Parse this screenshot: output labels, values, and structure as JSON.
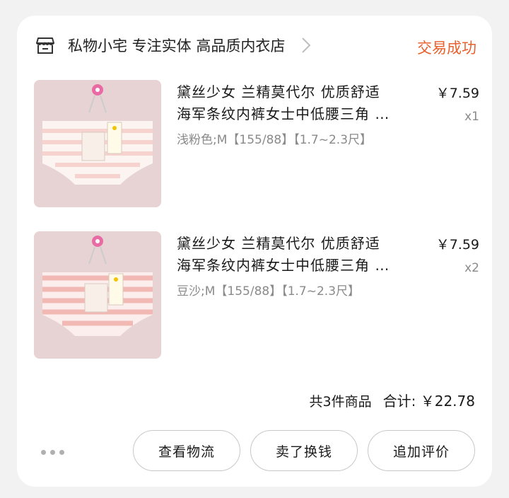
{
  "shop": {
    "name": "私物小宅  专注实体 高品质内衣店",
    "status": "交易成功"
  },
  "items": [
    {
      "title_line1": "黛丝少女 兰精莫代尔 优质舒适",
      "title_line2": "海军条纹内裤女士中低腰三角 …",
      "spec": "浅粉色;M【155/88】【1.7~2.3尺】",
      "price": "￥7.59",
      "qty": "x1"
    },
    {
      "title_line1": "黛丝少女 兰精莫代尔 优质舒适",
      "title_line2": "海军条纹内裤女士中低腰三角 …",
      "spec": "豆沙;M【155/88】【1.7~2.3尺】",
      "price": "￥7.59",
      "qty": "x2"
    }
  ],
  "summary": {
    "count_text": "共3件商品",
    "total_text": "合计: ￥22.78"
  },
  "actions": {
    "logistics": "查看物流",
    "resell": "卖了换钱",
    "review": "追加评价"
  },
  "colors": {
    "status": "#e8602c",
    "product1_stripe": "#f6d3cf",
    "product2_stripe": "#f2b9b4"
  }
}
